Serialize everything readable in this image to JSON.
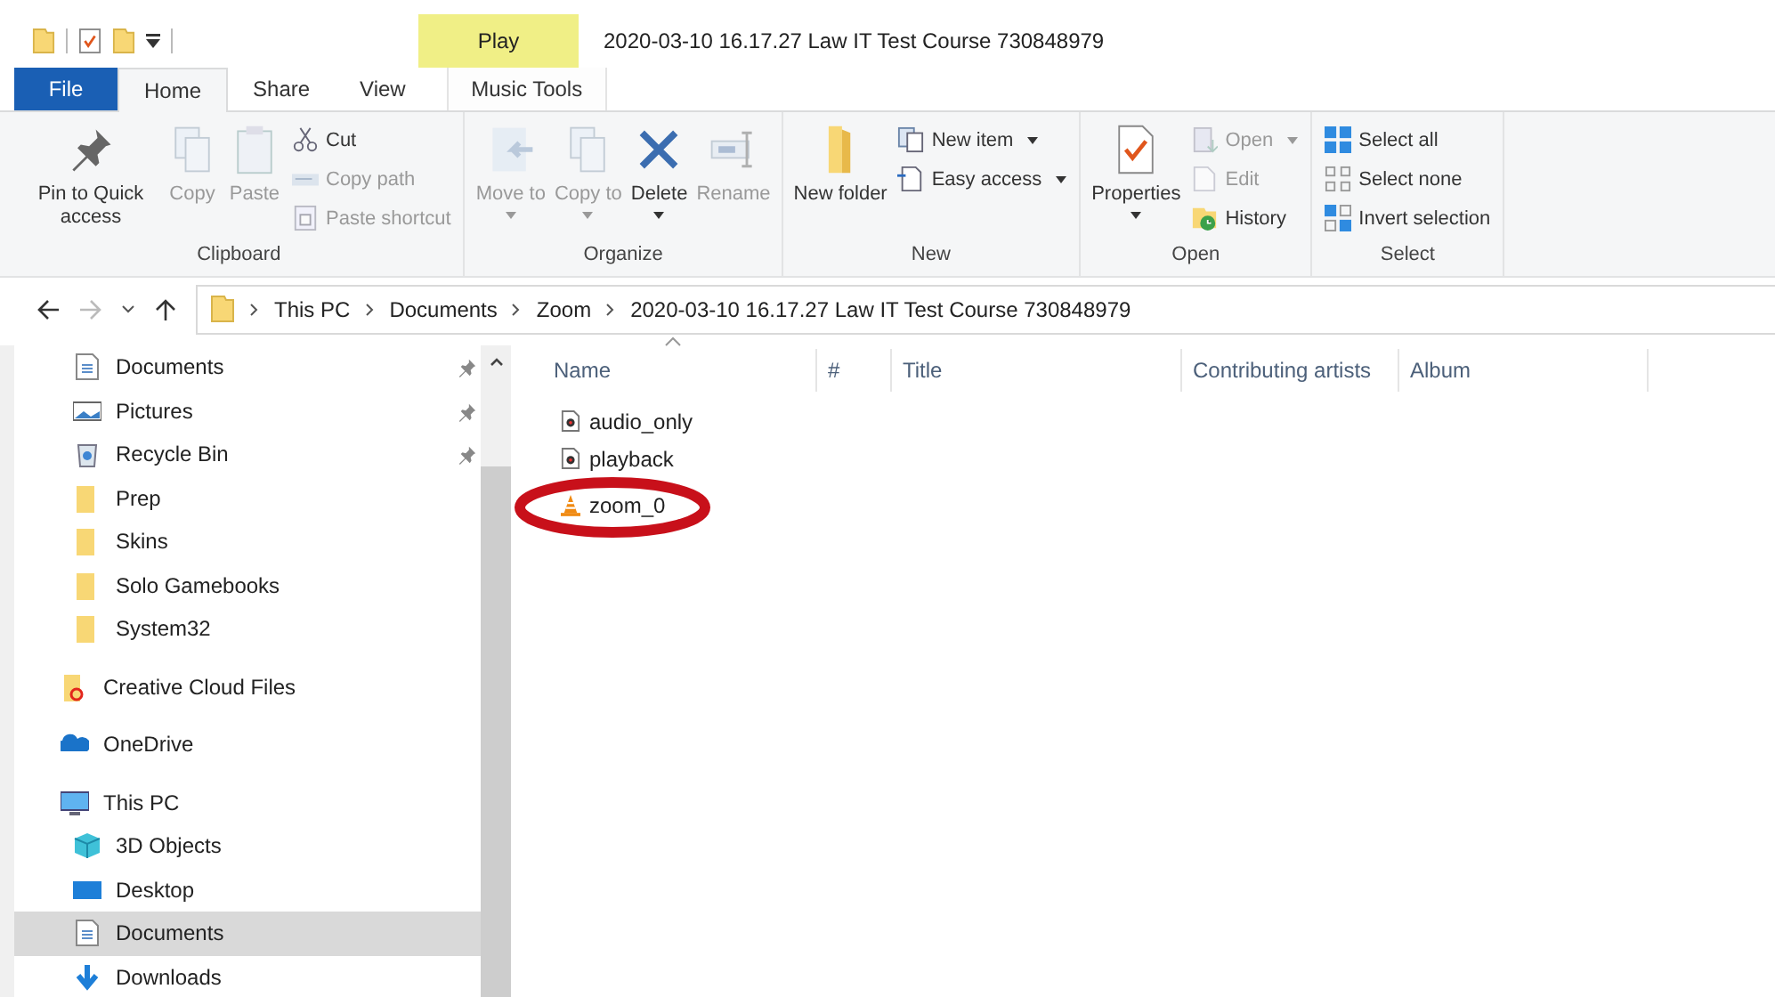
{
  "title_bar": {
    "contextual_tab": "Play",
    "title": "2020-03-10 16.17.27 Law IT Test Course 730848979"
  },
  "tabs": [
    {
      "label": "File",
      "kind": "file",
      "selected": false
    },
    {
      "label": "Home",
      "kind": "tab",
      "selected": true
    },
    {
      "label": "Share",
      "kind": "tab",
      "selected": false
    },
    {
      "label": "View",
      "kind": "tab",
      "selected": false
    },
    {
      "label": "Music Tools",
      "kind": "contextual",
      "selected": false
    }
  ],
  "ribbon": [
    {
      "label": "Clipboard",
      "items": [
        {
          "kind": "large",
          "label": "Pin to Quick access",
          "disabled": false
        },
        {
          "kind": "large",
          "label": "Copy",
          "disabled": true
        },
        {
          "kind": "large",
          "label": "Paste",
          "disabled": true
        },
        {
          "kind": "stack",
          "entries": [
            {
              "label": "Cut",
              "disabled": false
            },
            {
              "label": "Copy path",
              "disabled": true
            },
            {
              "label": "Paste shortcut",
              "disabled": true
            }
          ]
        }
      ]
    },
    {
      "label": "Organize",
      "items": [
        {
          "kind": "large",
          "label": "Move to",
          "dropdown": true,
          "disabled": true
        },
        {
          "kind": "large",
          "label": "Copy to",
          "dropdown": true,
          "disabled": true
        },
        {
          "kind": "large",
          "label": "Delete",
          "dropdown": true,
          "disabled": false
        },
        {
          "kind": "large",
          "label": "Rename",
          "disabled": true
        }
      ]
    },
    {
      "label": "New",
      "items": [
        {
          "kind": "large",
          "label": "New folder",
          "disabled": false
        },
        {
          "kind": "stack",
          "entries": [
            {
              "label": "New item",
              "dropdown": true,
              "disabled": false
            },
            {
              "label": "Easy access",
              "dropdown": true,
              "disabled": false
            }
          ]
        }
      ]
    },
    {
      "label": "Open",
      "items": [
        {
          "kind": "large",
          "label": "Properties",
          "dropdown": true,
          "disabled": false
        },
        {
          "kind": "stack",
          "entries": [
            {
              "label": "Open",
              "dropdown": true,
              "disabled": true
            },
            {
              "label": "Edit",
              "disabled": true
            },
            {
              "label": "History",
              "disabled": false
            }
          ]
        }
      ]
    },
    {
      "label": "Select",
      "items": [
        {
          "kind": "stack",
          "entries": [
            {
              "label": "Select all",
              "disabled": false
            },
            {
              "label": "Select none",
              "disabled": false
            },
            {
              "label": "Invert selection",
              "disabled": false
            }
          ]
        }
      ]
    }
  ],
  "address_bar": {
    "path": [
      "This PC",
      "Documents",
      "Zoom",
      "2020-03-10 16.17.27 Law IT Test Course 730848979"
    ]
  },
  "navigation": {
    "quick_access_items": [
      {
        "label": "Documents",
        "pinned": true,
        "selected": false
      },
      {
        "label": "Pictures",
        "pinned": true,
        "selected": false
      },
      {
        "label": "Recycle Bin",
        "pinned": true,
        "selected": false
      },
      {
        "label": "Prep",
        "pinned": false,
        "selected": false
      },
      {
        "label": "Skins",
        "pinned": false,
        "selected": false
      },
      {
        "label": "Solo Gamebooks",
        "pinned": false,
        "selected": false
      },
      {
        "label": "System32",
        "pinned": false,
        "selected": false
      }
    ],
    "items": [
      {
        "label": "Creative Cloud Files",
        "selected": false
      },
      {
        "label": "OneDrive",
        "selected": false
      },
      {
        "label": "This PC",
        "selected": false,
        "children": [
          {
            "label": "3D Objects",
            "selected": false
          },
          {
            "label": "Desktop",
            "selected": false
          },
          {
            "label": "Documents",
            "selected": true
          },
          {
            "label": "Downloads",
            "selected": false
          }
        ]
      }
    ]
  },
  "file_list": {
    "columns": [
      "Name",
      "#",
      "Title",
      "Contributing artists",
      "Album"
    ],
    "files": [
      {
        "name": "audio_only",
        "kind": "audio",
        "circled": false
      },
      {
        "name": "playback",
        "kind": "audio",
        "circled": false
      },
      {
        "name": "zoom_0",
        "kind": "vlc",
        "circled": true
      }
    ]
  }
}
